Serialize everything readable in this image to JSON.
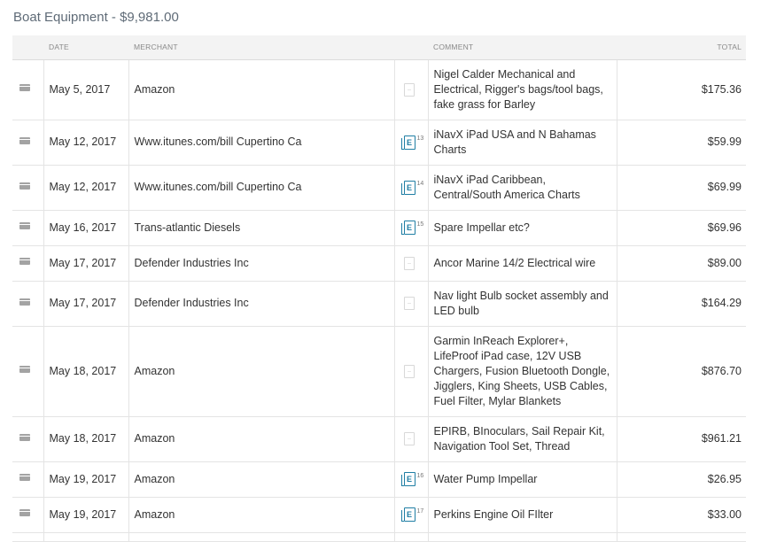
{
  "report": {
    "title": "Boat Equipment - $9,981.00"
  },
  "columns": {
    "date": "DATE",
    "merchant": "MERCHANT",
    "comment": "COMMENT",
    "total": "TOTAL"
  },
  "icons": {
    "card": "credit-card-icon",
    "receipt_empty": "empty-receipt-icon",
    "receipt_e": "e-receipt-icon"
  },
  "rows": [
    {
      "date": "May 5, 2017",
      "merchant": "Amazon",
      "receipt": "empty",
      "receipt_num": "",
      "comment": "Nigel Calder Mechanical and Electrical, Rigger's bags/tool bags, fake grass for Barley",
      "total": "$175.36"
    },
    {
      "date": "May 12, 2017",
      "merchant": "Www.itunes.com/bill Cupertino Ca",
      "receipt": "e",
      "receipt_num": "13",
      "comment": "iNavX iPad USA and N Bahamas Charts",
      "total": "$59.99"
    },
    {
      "date": "May 12, 2017",
      "merchant": "Www.itunes.com/bill Cupertino Ca",
      "receipt": "e",
      "receipt_num": "14",
      "comment": "iNavX iPad Caribbean, Central/South America Charts",
      "total": "$69.99"
    },
    {
      "date": "May 16, 2017",
      "merchant": "Trans-atlantic Diesels",
      "receipt": "e",
      "receipt_num": "15",
      "comment": "Spare Impellar etc?",
      "total": "$69.96"
    },
    {
      "date": "May 17, 2017",
      "merchant": "Defender Industries Inc",
      "receipt": "empty",
      "receipt_num": "",
      "comment": "Ancor Marine 14/2 Electrical wire",
      "total": "$89.00"
    },
    {
      "date": "May 17, 2017",
      "merchant": "Defender Industries Inc",
      "receipt": "empty",
      "receipt_num": "",
      "comment": "Nav light Bulb socket assembly and LED bulb",
      "total": "$164.29"
    },
    {
      "date": "May 18, 2017",
      "merchant": "Amazon",
      "receipt": "empty",
      "receipt_num": "",
      "comment": "Garmin InReach Explorer+, LifeProof iPad case, 12V USB Chargers, Fusion Bluetooth Dongle, Jigglers, King Sheets, USB Cables, Fuel Filter, Mylar Blankets",
      "total": "$876.70"
    },
    {
      "date": "May 18, 2017",
      "merchant": "Amazon",
      "receipt": "empty",
      "receipt_num": "",
      "comment": "EPIRB, BInoculars, Sail Repair Kit, Navigation Tool Set, Thread",
      "total": "$961.21"
    },
    {
      "date": "May 19, 2017",
      "merchant": "Amazon",
      "receipt": "e",
      "receipt_num": "16",
      "comment": "Water Pump Impellar",
      "total": "$26.95"
    },
    {
      "date": "May 19, 2017",
      "merchant": "Amazon",
      "receipt": "e",
      "receipt_num": "17",
      "comment": "Perkins Engine Oil FIlter",
      "total": "$33.00"
    }
  ]
}
